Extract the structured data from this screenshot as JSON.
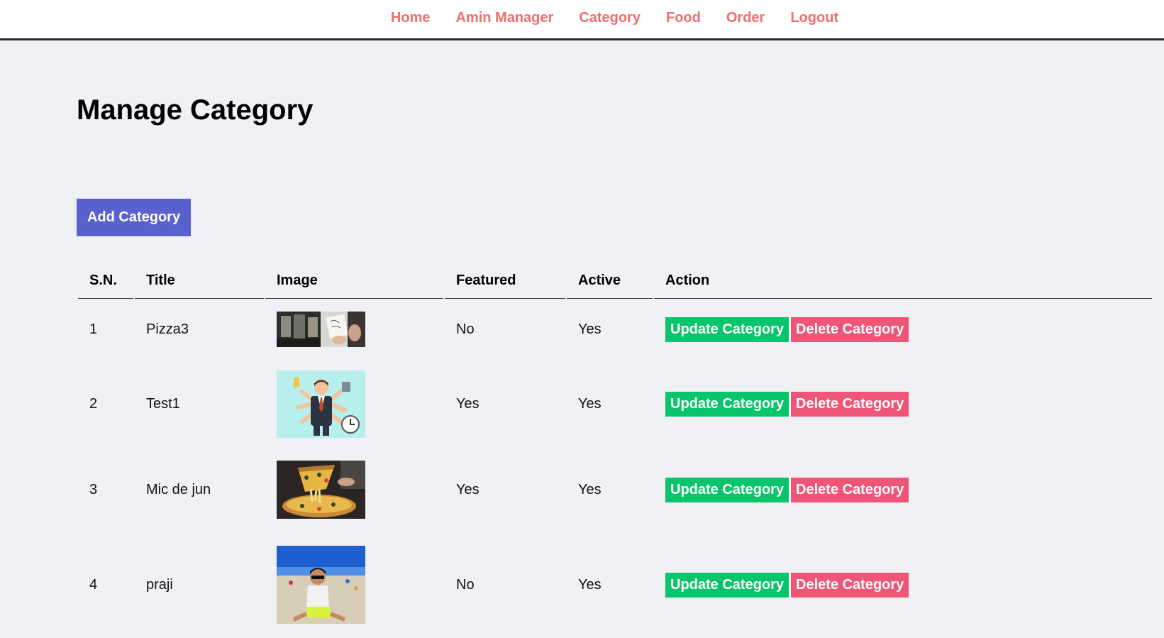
{
  "nav": [
    "Home",
    "Amin Manager",
    "Category",
    "Food",
    "Order",
    "Logout"
  ],
  "page_title": "Manage Category",
  "add_button": "Add Category",
  "table": {
    "headers": [
      "S.N.",
      "Title",
      "Image",
      "Featured",
      "Active",
      "Action"
    ],
    "rows": [
      {
        "sn": "1",
        "title": "Pizza3",
        "featured": "No",
        "active": "Yes"
      },
      {
        "sn": "2",
        "title": "Test1",
        "featured": "Yes",
        "active": "Yes"
      },
      {
        "sn": "3",
        "title": "Mic de jun",
        "featured": "Yes",
        "active": "Yes"
      },
      {
        "sn": "4",
        "title": "praji",
        "featured": "No",
        "active": "Yes"
      }
    ],
    "update_label": "Update Category",
    "delete_label": "Delete Category"
  },
  "colors": {
    "nav_link": "#ef6f6c",
    "add_button": "#5961cf",
    "update_button": "#08c46a",
    "delete_button": "#ef5577",
    "background": "#f0f1f5"
  }
}
